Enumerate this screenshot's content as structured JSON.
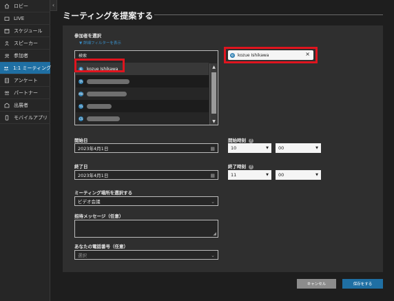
{
  "sidebar": {
    "items": [
      {
        "label": "ロビー",
        "icon": "home-icon",
        "active": false
      },
      {
        "label": "LIVE",
        "icon": "live-icon",
        "active": false
      },
      {
        "label": "スケジュール",
        "icon": "calendar-icon",
        "active": false
      },
      {
        "label": "スピーカー",
        "icon": "speaker-icon",
        "active": false
      },
      {
        "label": "参加者",
        "icon": "participants-icon",
        "active": false
      },
      {
        "label": "1:1 ミーティング",
        "icon": "meeting-icon",
        "active": true
      },
      {
        "label": "アンケート",
        "icon": "survey-icon",
        "active": false
      },
      {
        "label": "パートナー",
        "icon": "partner-icon",
        "active": false
      },
      {
        "label": "出展者",
        "icon": "exhibitor-icon",
        "active": false
      },
      {
        "label": "モバイルアプリ",
        "icon": "mobile-icon",
        "active": false
      }
    ],
    "collapse_glyph": "‹"
  },
  "page": {
    "title": "ミーティングを提案する"
  },
  "participants": {
    "section_label": "参加者を選択",
    "filter_link": "▼ 詳細フィルターを表示",
    "search_label": "検索",
    "first_item": {
      "initials": "KI",
      "name": "kozue Ishikawa"
    },
    "other_initials": [
      "TA",
      "MH",
      "YS",
      "CS"
    ],
    "selected": {
      "initials": "KI",
      "name": "kozue Ishikawa",
      "remove": "×"
    }
  },
  "start": {
    "date_label": "開始日",
    "date_value": "2023年4月1日",
    "time_label": "開始時刻",
    "hour": "10",
    "minute": "00"
  },
  "end": {
    "date_label": "終了日",
    "date_value": "2023年4月1日",
    "time_label": "終了時刻",
    "hour": "11",
    "minute": "00"
  },
  "location": {
    "label": "ミーティング場所を選択する",
    "value": "ビデオ会議"
  },
  "message": {
    "label": "招待メッセージ（任意）"
  },
  "phone": {
    "label": "あなたの電話番号（任意）",
    "placeholder": "選択"
  },
  "buttons": {
    "cancel": "キャンセル",
    "save": "保存をする"
  }
}
